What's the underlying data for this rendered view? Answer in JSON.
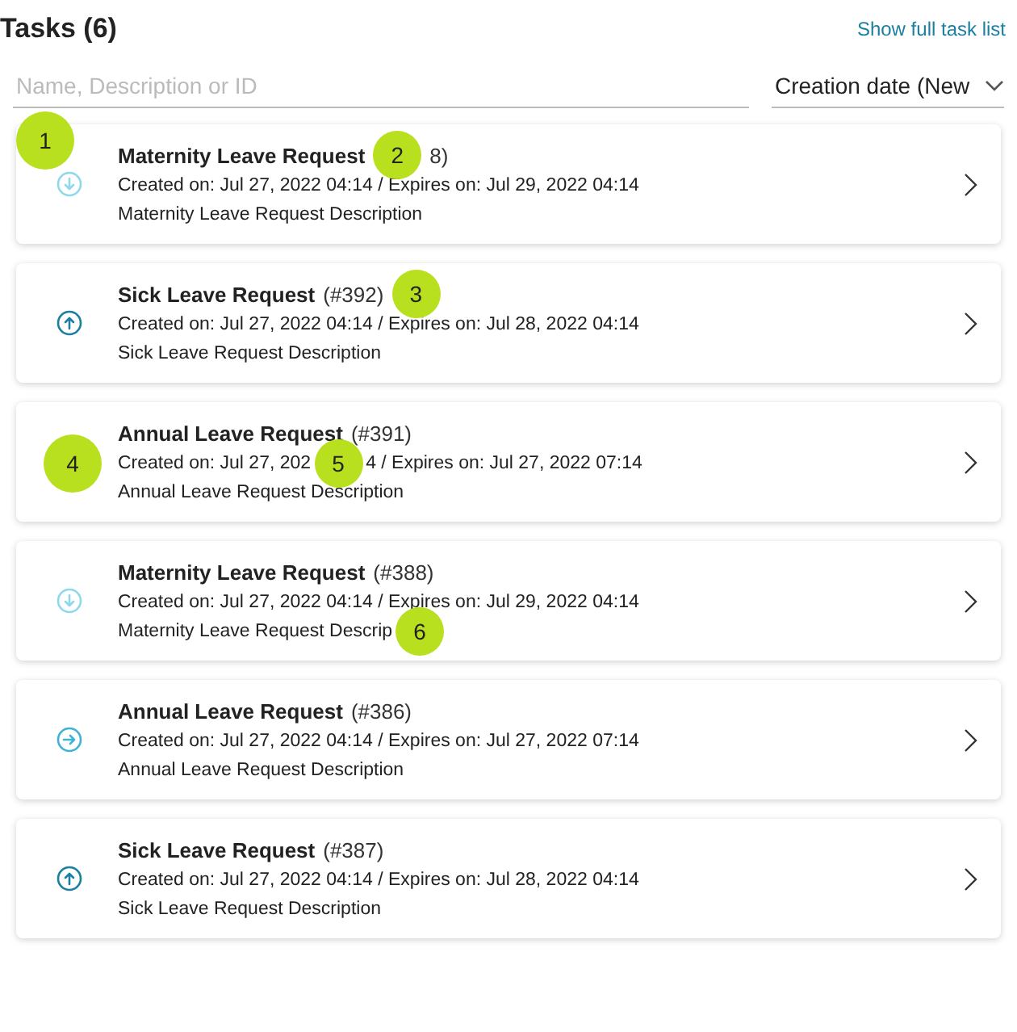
{
  "header": {
    "title": "Tasks (6)",
    "link": "Show full task list"
  },
  "search": {
    "placeholder": "Name, Description or ID"
  },
  "sort": {
    "value": "Creation date (New"
  },
  "tasks": [
    {
      "kind": "down",
      "marker": "1",
      "title": [
        {
          "kind": "name",
          "text": "Maternity Leave Request"
        },
        {
          "kind": "marker",
          "text": "2"
        },
        {
          "kind": "id",
          "text": "8)"
        }
      ],
      "dates": [
        {
          "kind": "text",
          "text": "Created on: Jul 27, 2022 04:14 / Expires on: Jul 29, 2022 04:14"
        }
      ],
      "description": [
        {
          "kind": "text",
          "text": "Maternity Leave Request Description"
        }
      ]
    },
    {
      "kind": "up",
      "title": [
        {
          "kind": "name",
          "text": "Sick Leave Request"
        },
        {
          "kind": "id",
          "text": "(#392)"
        },
        {
          "kind": "marker",
          "text": "3"
        }
      ],
      "dates": [
        {
          "kind": "text",
          "text": "Created on: Jul 27, 2022 04:14 / Expires on: Jul 28, 2022 04:14"
        }
      ],
      "description": [
        {
          "kind": "text",
          "text": "Sick Leave Request Description"
        }
      ]
    },
    {
      "kind": "covered",
      "marker": "4",
      "title": [
        {
          "kind": "name",
          "text": "Annual Leave Request"
        },
        {
          "kind": "id",
          "text": "(#391)"
        }
      ],
      "dates": [
        {
          "kind": "text",
          "text": "Created on: Jul 27, 202"
        },
        {
          "kind": "marker",
          "text": "5"
        },
        {
          "kind": "text",
          "text": "4 / Expires on: Jul 27, 2022 07:14"
        }
      ],
      "description": [
        {
          "kind": "text",
          "text": "Annual Leave Request Description"
        }
      ]
    },
    {
      "kind": "down",
      "title": [
        {
          "kind": "name",
          "text": "Maternity Leave Request"
        },
        {
          "kind": "id",
          "text": "(#388)"
        }
      ],
      "dates": [
        {
          "kind": "text",
          "text": "Created on: Jul 27, 2022 04:14 / Expires on: Jul 29, 2022 04:14"
        }
      ],
      "description": [
        {
          "kind": "text",
          "text": "Maternity Leave Request Descrip"
        },
        {
          "kind": "marker",
          "text": "6"
        }
      ]
    },
    {
      "kind": "right",
      "title": [
        {
          "kind": "name",
          "text": "Annual Leave Request"
        },
        {
          "kind": "id",
          "text": "(#386)"
        }
      ],
      "dates": [
        {
          "kind": "text",
          "text": "Created on: Jul 27, 2022 04:14 / Expires on: Jul 27, 2022 07:14"
        }
      ],
      "description": [
        {
          "kind": "text",
          "text": "Annual Leave Request Description"
        }
      ]
    },
    {
      "kind": "up",
      "title": [
        {
          "kind": "name",
          "text": "Sick Leave Request"
        },
        {
          "kind": "id",
          "text": "(#387)"
        }
      ],
      "dates": [
        {
          "kind": "text",
          "text": "Created on: Jul 27, 2022 04:14 / Expires on: Jul 28, 2022 04:14"
        }
      ],
      "description": [
        {
          "kind": "text",
          "text": "Sick Leave Request Description"
        }
      ]
    }
  ]
}
